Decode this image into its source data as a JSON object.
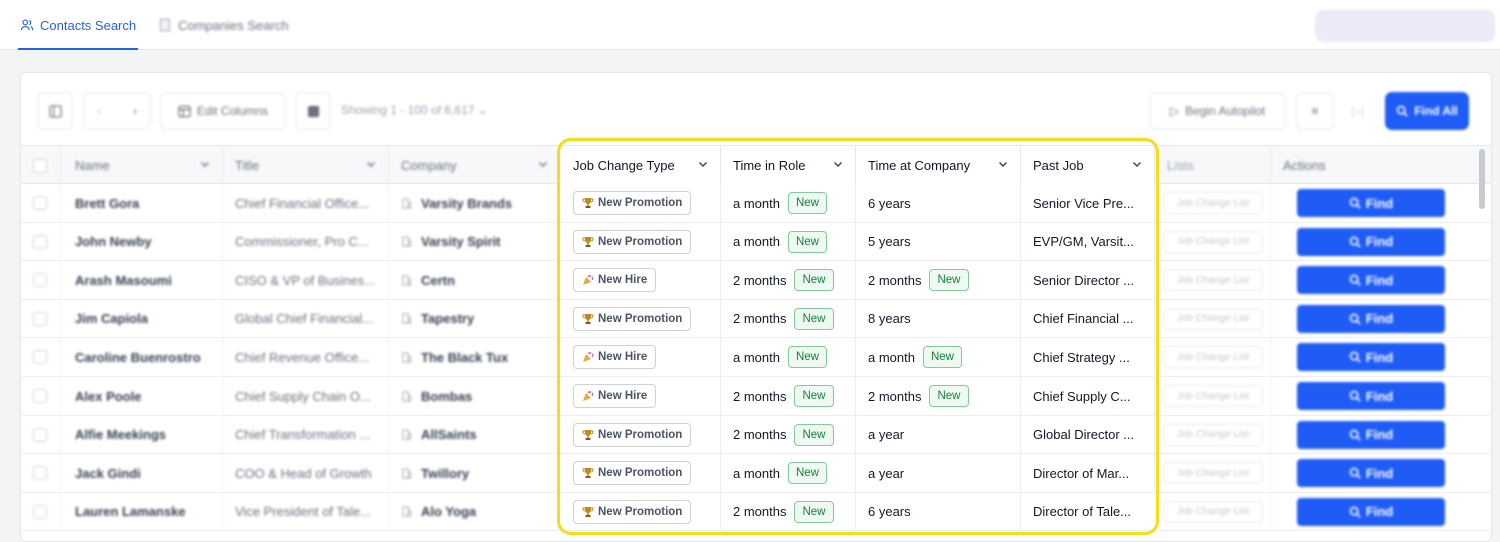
{
  "tabs": [
    {
      "label": "Contacts Search",
      "icon": "users-icon",
      "active": true
    },
    {
      "label": "Companies Search",
      "icon": "building-icon",
      "active": false
    }
  ],
  "toolbar": {
    "edit_columns": "Edit Columns",
    "showing": "Showing 1 - 100 of 6,617",
    "begin_autopilot": "Begin Autopilot",
    "find_all": "Find All"
  },
  "columns": {
    "name": "Name",
    "title": "Title",
    "company": "Company",
    "job_change_type": "Job Change Type",
    "time_in_role": "Time in Role",
    "time_at_company": "Time at Company",
    "past_job": "Past Job",
    "lists": "Lists",
    "actions": "Actions"
  },
  "list_pill": "Job Change List",
  "find_label": "Find",
  "new_label": "New",
  "rows": [
    {
      "name": "Brett Gora",
      "title": "Chief Financial Office...",
      "company": "Varsity Brands",
      "type": "New Promotion",
      "type_icon": "trophy",
      "role": "a month",
      "role_new": true,
      "tenure": "6 years",
      "tenure_new": false,
      "past": "Senior Vice Pre..."
    },
    {
      "name": "John Newby",
      "title": "Commissioner, Pro C...",
      "company": "Varsity Spirit",
      "type": "New Promotion",
      "type_icon": "trophy",
      "role": "a month",
      "role_new": true,
      "tenure": "5 years",
      "tenure_new": false,
      "past": "EVP/GM, Varsit..."
    },
    {
      "name": "Arash Masoumi",
      "title": "CISO & VP of Busines...",
      "company": "Certn",
      "type": "New Hire",
      "type_icon": "party",
      "role": "2 months",
      "role_new": true,
      "tenure": "2 months",
      "tenure_new": true,
      "past": "Senior Director ..."
    },
    {
      "name": "Jim Capiola",
      "title": "Global Chief Financial...",
      "company": "Tapestry",
      "type": "New Promotion",
      "type_icon": "trophy",
      "role": "2 months",
      "role_new": true,
      "tenure": "8 years",
      "tenure_new": false,
      "past": "Chief Financial ..."
    },
    {
      "name": "Caroline Buenrostro",
      "title": "Chief Revenue Office...",
      "company": "The Black Tux",
      "type": "New Hire",
      "type_icon": "party",
      "role": "a month",
      "role_new": true,
      "tenure": "a month",
      "tenure_new": true,
      "past": "Chief Strategy ..."
    },
    {
      "name": "Alex Poole",
      "title": "Chief Supply Chain O...",
      "company": "Bombas",
      "type": "New Hire",
      "type_icon": "party",
      "role": "2 months",
      "role_new": true,
      "tenure": "2 months",
      "tenure_new": true,
      "past": "Chief Supply C..."
    },
    {
      "name": "Alfie Meekings",
      "title": "Chief Transformation ...",
      "company": "AllSaints",
      "type": "New Promotion",
      "type_icon": "trophy",
      "role": "2 months",
      "role_new": true,
      "tenure": "a year",
      "tenure_new": false,
      "past": "Global Director ..."
    },
    {
      "name": "Jack Gindi",
      "title": "COO & Head of Growth",
      "company": "Twillory",
      "type": "New Promotion",
      "type_icon": "trophy",
      "role": "a month",
      "role_new": true,
      "tenure": "a year",
      "tenure_new": false,
      "past": "Director of Mar..."
    },
    {
      "name": "Lauren Lamanske",
      "title": "Vice President of Tale...",
      "company": "Alo Yoga",
      "type": "New Promotion",
      "type_icon": "trophy",
      "role": "2 months",
      "role_new": true,
      "tenure": "6 years",
      "tenure_new": false,
      "past": "Director of Tale..."
    }
  ],
  "colors": {
    "accent": "#1e5cf5",
    "highlight": "#f5dd1e",
    "new_green": "#15803d"
  }
}
